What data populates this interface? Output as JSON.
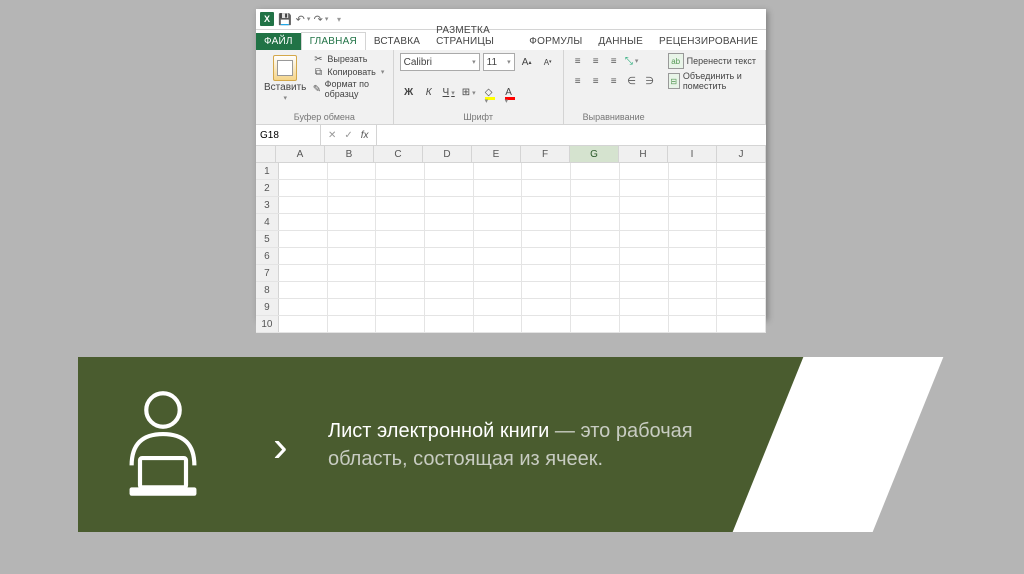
{
  "qat": {
    "undo": "↶",
    "redo": "↷"
  },
  "tabs": {
    "file": "ФАЙЛ",
    "home": "ГЛАВНАЯ",
    "insert": "ВСТАВКА",
    "layout": "РАЗМЕТКА СТРАНИЦЫ",
    "formulas": "ФОРМУЛЫ",
    "data": "ДАННЫЕ",
    "review": "РЕЦЕНЗИРОВАНИЕ"
  },
  "ribbon": {
    "paste": "Вставить",
    "cut": "Вырезать",
    "copy": "Копировать",
    "format_painter": "Формат по образцу",
    "clipboard_group": "Буфер обмена",
    "font_name": "Calibri",
    "font_size": "11",
    "bold": "Ж",
    "italic": "К",
    "underline": "Ч",
    "font_group": "Шрифт",
    "wrap": "Перенести текст",
    "merge": "Объединить и поместить",
    "align_group": "Выравнивание"
  },
  "namebox": "G18",
  "fx_label": "fx",
  "columns": [
    "A",
    "B",
    "C",
    "D",
    "E",
    "F",
    "G",
    "H",
    "I",
    "J"
  ],
  "selected_col": "G",
  "rows": [
    1,
    2,
    3,
    4,
    5,
    6,
    7,
    8,
    9,
    10
  ],
  "banner": {
    "bold": "Лист электронной книги",
    "rest": " — это рабочая область, состоящая из ячеек."
  }
}
